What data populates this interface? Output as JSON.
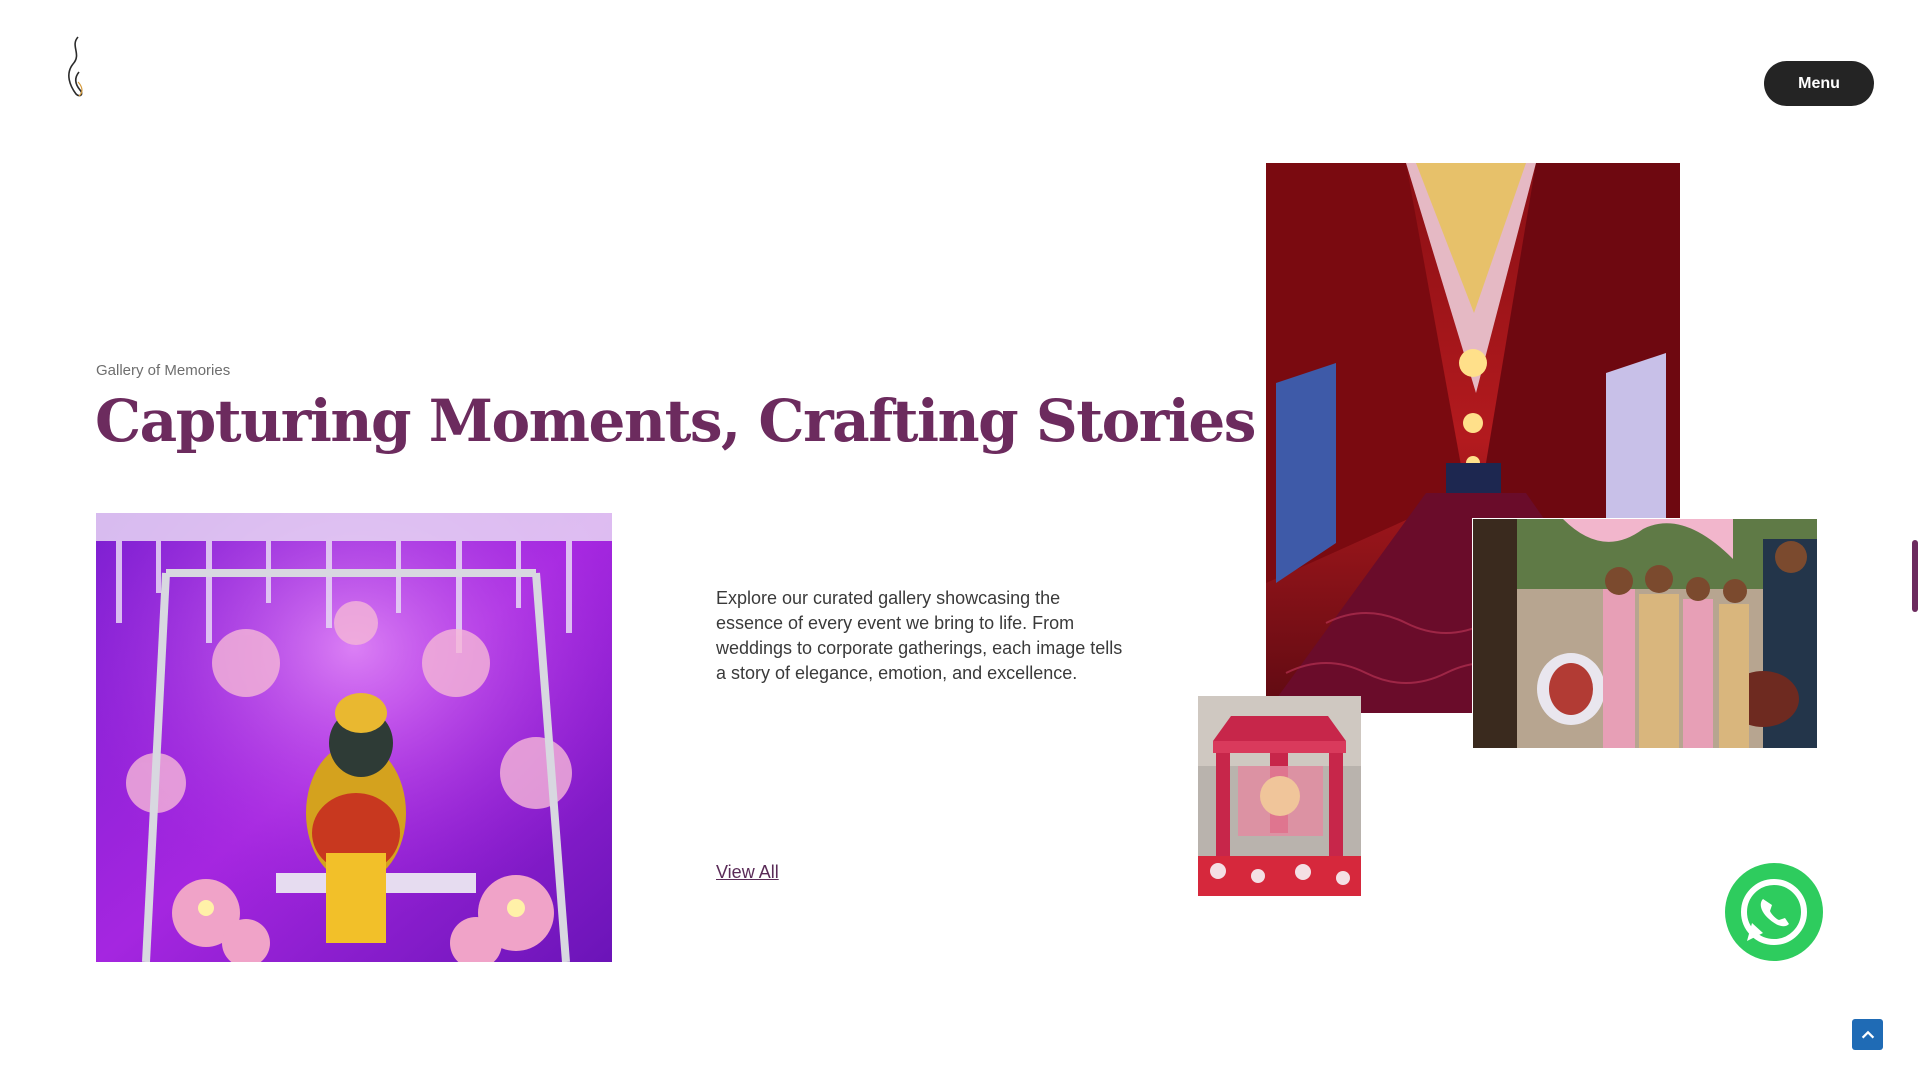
{
  "header": {
    "logo_icon": "flame-swirl-logo",
    "menu_label": "Menu"
  },
  "section": {
    "eyebrow": "Gallery of Memories",
    "headline": "Capturing Moments, Crafting Stories",
    "description": "Explore our curated gallery showcasing the essence of every event we bring to life. From weddings to corporate gatherings, each image tells a story of elegance, emotion, and excellence.",
    "view_all_label": "View All"
  },
  "gallery": [
    {
      "subject": "ganesha-swing-decor"
    },
    {
      "subject": "red-draped-entrance-corridor"
    },
    {
      "subject": "dhol-dance-celebration"
    },
    {
      "subject": "floral-wedding-mandap"
    }
  ],
  "floating": {
    "whatsapp_icon": "whatsapp-icon",
    "scroll_top_icon": "chevron-up-icon"
  },
  "colors": {
    "accent": "#6c2b5e",
    "menu_bg": "#242424",
    "whatsapp": "#2ecc5e",
    "scroll_top": "#1f6bb5"
  }
}
